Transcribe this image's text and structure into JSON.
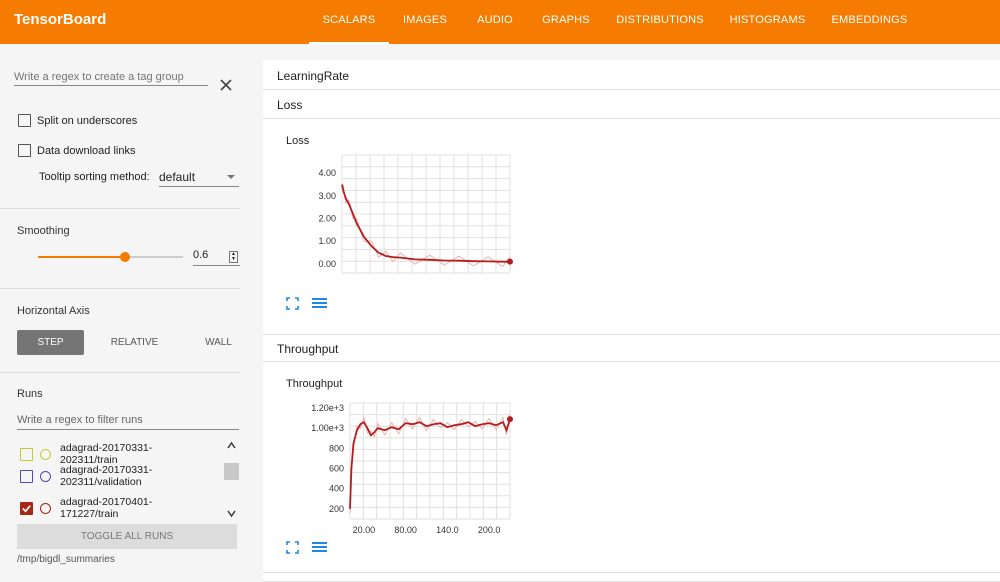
{
  "app": {
    "title": "TensorBoard"
  },
  "tabs": [
    {
      "label": "SCALARS",
      "active": true
    },
    {
      "label": "IMAGES"
    },
    {
      "label": "AUDIO"
    },
    {
      "label": "GRAPHS"
    },
    {
      "label": "DISTRIBUTIONS"
    },
    {
      "label": "HISTOGRAMS"
    },
    {
      "label": "EMBEDDINGS"
    }
  ],
  "colors": {
    "accent": "#f57c00",
    "line": "#b71c1c",
    "line_raw": "#e8b4b0"
  },
  "sidebar": {
    "tag_regex_placeholder": "Write a regex to create a tag group",
    "split_underscores": "Split on underscores",
    "data_download": "Data download links",
    "tooltip_label": "Tooltip sorting method:",
    "tooltip_value": "default",
    "smoothing_title": "Smoothing",
    "smoothing_value": "0.6",
    "smoothing_fraction": 0.6,
    "haxis_title": "Horizontal Axis",
    "haxis_options": [
      "STEP",
      "RELATIVE",
      "WALL"
    ],
    "runs_title": "Runs",
    "runs_filter_placeholder": "Write a regex to filter runs",
    "runs": [
      {
        "label": "adagrad-20170331-202311/train",
        "color": "#c6c933",
        "checked": false
      },
      {
        "label": "adagrad-20170331-202311/validation",
        "color": "#5b44b4",
        "checked": false
      },
      {
        "label": "adagrad-20170401-171227/train",
        "color": "#a52714",
        "checked": true
      }
    ],
    "toggle_all": "TOGGLE ALL RUNS",
    "logdir": "/tmp/bigdl_summaries"
  },
  "groups": {
    "learning_rate": "LearningRate",
    "loss": "Loss",
    "throughput": "Throughput"
  },
  "chart_data": [
    {
      "type": "line",
      "title": "Loss",
      "xlabel": "",
      "ylabel": "",
      "x": [
        0,
        2,
        5,
        10,
        15,
        20,
        30,
        40,
        50,
        60,
        70,
        80,
        100,
        120,
        140,
        160,
        180,
        200,
        220,
        230
      ],
      "series": [
        {
          "values": [
            3.5,
            3.2,
            2.9,
            2.6,
            2.2,
            1.8,
            1.2,
            0.8,
            0.5,
            0.35,
            0.3,
            0.28,
            0.2,
            0.18,
            0.15,
            0.14,
            0.12,
            0.11,
            0.1,
            0.1
          ]
        }
      ],
      "yticks": [
        "4.00",
        "3.00",
        "2.00",
        "1.00",
        "0.00"
      ],
      "ylim": [
        -0.4,
        4.8
      ],
      "grid": true
    },
    {
      "type": "line",
      "title": "Throughput",
      "xlabel": "",
      "ylabel": "",
      "x": [
        0,
        2,
        5,
        10,
        15,
        20,
        25,
        30,
        35,
        40,
        50,
        60,
        70,
        80,
        90,
        100,
        110,
        120,
        130,
        140,
        150,
        160,
        170,
        180,
        190,
        200,
        210,
        220,
        225,
        230
      ],
      "series": [
        {
          "values": [
            200,
            600,
            850,
            980,
            1040,
            1060,
            1000,
            930,
            960,
            1000,
            980,
            1010,
            990,
            1050,
            1040,
            1060,
            1020,
            1040,
            1050,
            1010,
            1030,
            1040,
            1060,
            1020,
            1040,
            1050,
            1030,
            1060,
            980,
            1090
          ]
        }
      ],
      "yticks": [
        "1.20e+3",
        "1.00e+3",
        "800",
        "600",
        "400",
        "200"
      ],
      "xticks": [
        "20.00",
        "80.00",
        "140.0",
        "200.0"
      ],
      "ylim": [
        100,
        1250
      ],
      "grid": true
    }
  ]
}
